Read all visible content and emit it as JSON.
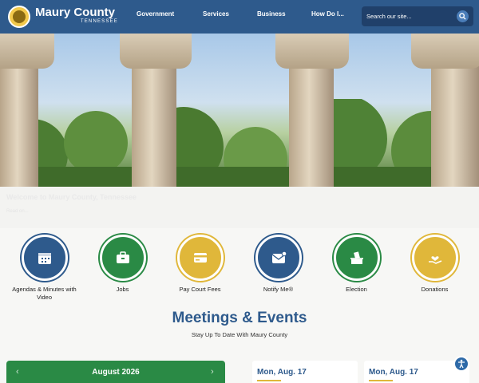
{
  "header": {
    "brand_name": "Maury County",
    "brand_state": "TENNESSEE",
    "nav": [
      "Government",
      "Services",
      "Business",
      "How Do I..."
    ],
    "search_placeholder": "Search our site..."
  },
  "hero": {
    "caption_title": "Welcome to Maury County, Tennessee",
    "caption_sub": "Read on..."
  },
  "quick_links": [
    {
      "label": "Agendas & Minutes with Video",
      "color": "#2e5a8c",
      "icon": "calendar-icon"
    },
    {
      "label": "Jobs",
      "color": "#2a8a45",
      "icon": "briefcase-icon"
    },
    {
      "label": "Pay Court Fees",
      "color": "#e0b73a",
      "icon": "credit-card-icon"
    },
    {
      "label": "Notify Me®",
      "color": "#2e5a8c",
      "icon": "envelope-icon"
    },
    {
      "label": "Election",
      "color": "#2a8a45",
      "icon": "ballot-box-icon"
    },
    {
      "label": "Donations",
      "color": "#e0b73a",
      "icon": "heart-hand-icon"
    }
  ],
  "meetings": {
    "title": "Meetings & Events",
    "subtitle": "Stay Up To Date With Maury County"
  },
  "calendar": {
    "month": "August 2026",
    "prev": "‹",
    "next": "›"
  },
  "events": [
    {
      "date": "Mon, Aug. 17"
    },
    {
      "date": "Mon, Aug. 17"
    }
  ],
  "colors": {
    "primary_blue": "#2e5a8c",
    "green": "#2a8a45",
    "gold": "#e0b73a"
  }
}
